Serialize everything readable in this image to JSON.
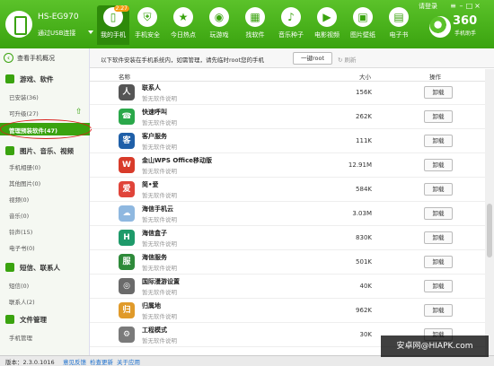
{
  "device": {
    "name": "HS-EG970",
    "connection": "通过USB连接"
  },
  "nav": {
    "tabs": [
      {
        "label": "我的手机",
        "icon": "phone-icon",
        "badge": "2.27",
        "active": true
      },
      {
        "label": "手机安全",
        "icon": "shield-icon"
      },
      {
        "label": "今日热点",
        "icon": "star-icon"
      },
      {
        "label": "玩游戏",
        "icon": "gamepad-icon"
      },
      {
        "label": "找软件",
        "icon": "apps-icon"
      },
      {
        "label": "音乐种子",
        "icon": "music-icon"
      },
      {
        "label": "电影视频",
        "icon": "video-icon"
      },
      {
        "label": "图片壁纸",
        "icon": "image-icon"
      },
      {
        "label": "电子书",
        "icon": "book-icon"
      }
    ],
    "login": "请登录",
    "brand": {
      "number": "360",
      "sub": "手机助手"
    }
  },
  "sidebar": {
    "back": "查看手机概况",
    "sections": [
      {
        "title": "游戏、软件",
        "items": [
          {
            "label": "已安装(36)"
          },
          {
            "label": "可升级(27)"
          },
          {
            "label": "管理预装软件(47)",
            "selected": true
          }
        ]
      },
      {
        "title": "图片、音乐、视频",
        "items": [
          {
            "label": "手机相册(0)"
          },
          {
            "label": "其他图片(0)"
          },
          {
            "label": "视频(0)"
          },
          {
            "label": "音乐(0)"
          },
          {
            "label": "铃声(15)"
          },
          {
            "label": "电子书(0)"
          }
        ]
      },
      {
        "title": "短信、联系人",
        "items": [
          {
            "label": "短信(0)"
          },
          {
            "label": "联系人(2)"
          }
        ]
      },
      {
        "title": "文件管理",
        "items": [
          {
            "label": "手机管理"
          }
        ]
      }
    ]
  },
  "infobar": {
    "text": "以下软件安装在手机系统内，如需管理，请先临时root您的手机",
    "root_button": "一键root",
    "refresh": "刷新"
  },
  "table": {
    "headers": {
      "name": "名称",
      "size": "大小",
      "action": "操作"
    },
    "rows": [
      {
        "name": "联系人",
        "desc": "暂无软件说明",
        "size": "156K",
        "icon": "contacts-icon",
        "color": "#555555",
        "glyph": "人"
      },
      {
        "name": "快速呼叫",
        "desc": "暂无软件说明",
        "size": "262K",
        "icon": "phone-call-icon",
        "color": "#2aa84a",
        "glyph": "☎"
      },
      {
        "name": "客户服务",
        "desc": "暂无软件说明",
        "size": "111K",
        "icon": "customer-service-icon",
        "color": "#1f5fa8",
        "glyph": "客"
      },
      {
        "name": "金山WPS Office移动版",
        "desc": "暂无软件说明",
        "size": "12.91M",
        "icon": "wps-office-icon",
        "color": "#d83b2a",
        "glyph": "W"
      },
      {
        "name": "简•爱",
        "desc": "暂无软件说明",
        "size": "584K",
        "icon": "jianai-icon",
        "color": "#e0443a",
        "glyph": "爱"
      },
      {
        "name": "海信手机云",
        "desc": "暂无软件说明",
        "size": "3.03M",
        "icon": "cloud-icon",
        "color": "#8fb8e0",
        "glyph": "☁"
      },
      {
        "name": "海信盒子",
        "desc": "暂无软件说明",
        "size": "830K",
        "icon": "hisense-box-icon",
        "color": "#1e9a6a",
        "glyph": "H"
      },
      {
        "name": "海信服务",
        "desc": "暂无软件说明",
        "size": "501K",
        "icon": "hisense-service-icon",
        "color": "#2e8a3a",
        "glyph": "服"
      },
      {
        "name": "国际漫游设置",
        "desc": "暂无软件说明",
        "size": "40K",
        "icon": "roaming-icon",
        "color": "#6a6a6a",
        "glyph": "◎"
      },
      {
        "name": "归属地",
        "desc": "暂无软件说明",
        "size": "962K",
        "icon": "location-icon",
        "color": "#e09a2a",
        "glyph": "归"
      },
      {
        "name": "工程模式",
        "desc": "暂无软件说明",
        "size": "30K",
        "icon": "engineering-icon",
        "color": "#7a7a7a",
        "glyph": "⚙"
      }
    ],
    "uninstall_label": "卸载"
  },
  "status": {
    "version": "版本：2.3.0.1016",
    "feedback": "意见反馈",
    "update": "检查更新",
    "about": "关于应用"
  },
  "watermark": "安卓网@HIAPK.com"
}
